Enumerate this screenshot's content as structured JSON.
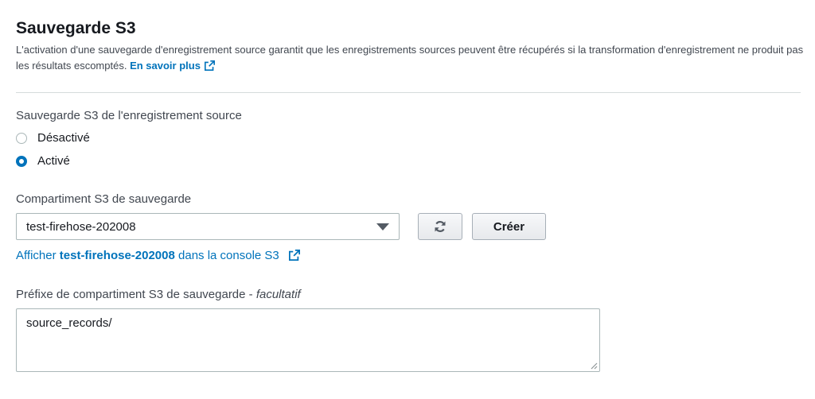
{
  "section": {
    "title": "Sauvegarde S3",
    "description": "L'activation d'une sauvegarde d'enregistrement source garantit que les enregistrements sources peuvent être récupérés si la transformation d'enregistrement ne produit pas les résultats escomptés.",
    "learn_more": "En savoir plus"
  },
  "source_backup": {
    "label": "Sauvegarde S3 de l'enregistrement source",
    "options": [
      {
        "label": "Désactivé",
        "checked": false
      },
      {
        "label": "Activé",
        "checked": true
      }
    ]
  },
  "bucket": {
    "label": "Compartiment S3 de sauvegarde",
    "selected": "test-firehose-202008",
    "create_label": "Créer",
    "console_link_prefix": "Afficher",
    "console_link_bucket": "test-firehose-202008",
    "console_link_suffix": "dans la console S3"
  },
  "prefix": {
    "label": "Préfixe de compartiment S3 de sauvegarde -",
    "optional": "facultatif",
    "value": "source_records/"
  },
  "colors": {
    "link": "#0073bb",
    "radio_selected": "#0073bb",
    "border": "#aab7b8",
    "divider": "#d5dbdb"
  },
  "icons": [
    "external-link-icon",
    "refresh-icon",
    "dropdown-caret-icon",
    "resize-grip-icon"
  ]
}
